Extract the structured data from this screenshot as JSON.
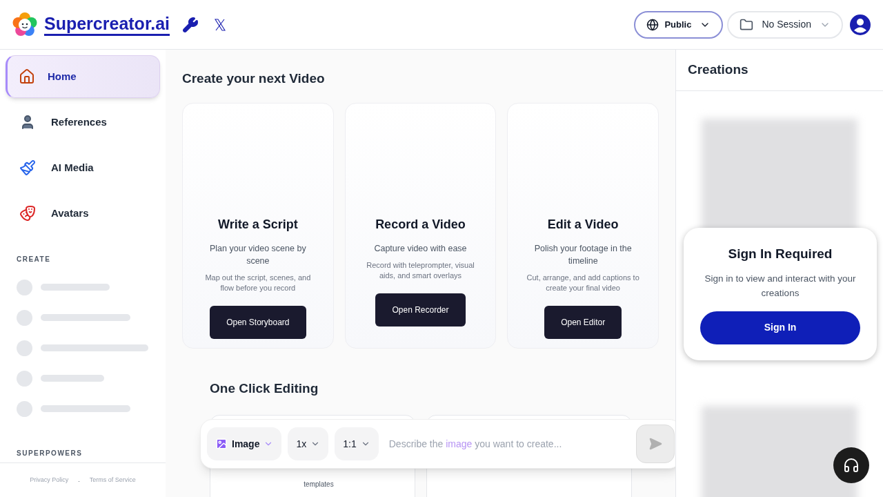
{
  "header": {
    "brand": "Supercreator.ai",
    "visibility": {
      "label": "Public"
    },
    "session": {
      "label": "No Session"
    }
  },
  "sidebar": {
    "items": [
      {
        "label": "Home",
        "selected": true
      },
      {
        "label": "References",
        "selected": false
      },
      {
        "label": "AI Media",
        "selected": false
      },
      {
        "label": "Avatars",
        "selected": false
      }
    ],
    "sections": [
      "CREATE",
      "SUPERPOWERS"
    ],
    "footer_links": [
      "Privacy Policy",
      "Terms of Service"
    ],
    "footer_separator": "."
  },
  "main": {
    "title": "Create your next Video",
    "cards": [
      {
        "title": "Write a Script",
        "subtitle": "Plan your video scene by scene",
        "description": "Map out the script, scenes, and flow before you record",
        "button": "Open Storyboard"
      },
      {
        "title": "Record a Video",
        "subtitle": "Capture video with ease",
        "description": "Record with teleprompter, visual aids, and smart overlays",
        "button": "Open Recorder"
      },
      {
        "title": "Edit a Video",
        "subtitle": "Polish your footage in the timeline",
        "description": "Cut, arrange, and add captions to create your final video",
        "button": "Open Editor"
      }
    ],
    "one_click": {
      "title": "One Click Editing",
      "cards": [
        {
          "description": "templates"
        }
      ]
    }
  },
  "prompt_bar": {
    "mode": "Image",
    "multiplier": "1x",
    "ratio": "1:1",
    "placeholder": [
      "Describe the ",
      "image",
      " you want to create..."
    ]
  },
  "creations": {
    "title": "Creations",
    "sign_in": {
      "title": "Sign In Required",
      "message": "Sign in to view and interact with your creations",
      "button": "Sign In"
    }
  }
}
